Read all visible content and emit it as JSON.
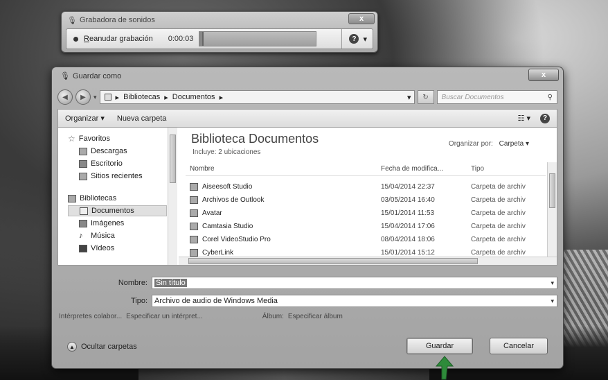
{
  "recorder": {
    "title": "Grabadora de sonidos",
    "resume_label": "Reanudar grabación",
    "resume_mnemonic": "R",
    "resume_rest": "eanudar grabación",
    "time": "0:00:03",
    "close": "x"
  },
  "dialog": {
    "title": "Guardar como",
    "close": "x",
    "breadcrumb": [
      "Bibliotecas",
      "Documentos"
    ],
    "search_placeholder": "Buscar Documentos",
    "toolbar": {
      "organize": "Organizar ▾",
      "new_folder": "Nueva carpeta"
    },
    "nav": {
      "favorites": "Favoritos",
      "favorites_items": [
        "Descargas",
        "Escritorio",
        "Sitios recientes"
      ],
      "libraries": "Bibliotecas",
      "libraries_items": [
        "Documentos",
        "Imágenes",
        "Música",
        "Vídeos"
      ]
    },
    "library": {
      "title": "Biblioteca Documentos",
      "subtitle": "Incluye: 2 ubicaciones",
      "arrange_label": "Organizar por:",
      "arrange_value": "Carpeta ▾"
    },
    "columns": {
      "name": "Nombre",
      "date": "Fecha de modifica...",
      "type": "Tipo"
    },
    "files": [
      {
        "name": "Aiseesoft Studio",
        "date": "15/04/2014 22:37",
        "type": "Carpeta de archiv"
      },
      {
        "name": "Archivos de Outlook",
        "date": "03/05/2014 16:40",
        "type": "Carpeta de archiv"
      },
      {
        "name": "Avatar",
        "date": "15/01/2014 11:53",
        "type": "Carpeta de archiv"
      },
      {
        "name": "Camtasia Studio",
        "date": "15/04/2014 17:06",
        "type": "Carpeta de archiv"
      },
      {
        "name": "Corel VideoStudio Pro",
        "date": "08/04/2014 18:06",
        "type": "Carpeta de archiv"
      },
      {
        "name": "CyberLink",
        "date": "15/01/2014 15:12",
        "type": "Carpeta de archiv"
      }
    ],
    "form": {
      "name_label": "Nombre:",
      "name_value": "Sin título",
      "type_label": "Tipo:",
      "type_value": "Archivo de audio de Windows Media",
      "artists_label": "Intérpretes colabor...",
      "artists_value": "Especificar un intérpret...",
      "album_label": "Álbum:",
      "album_value": "Especificar álbum"
    },
    "hide_folders": "Ocultar carpetas",
    "save": "Guardar",
    "cancel": "Cancelar"
  }
}
